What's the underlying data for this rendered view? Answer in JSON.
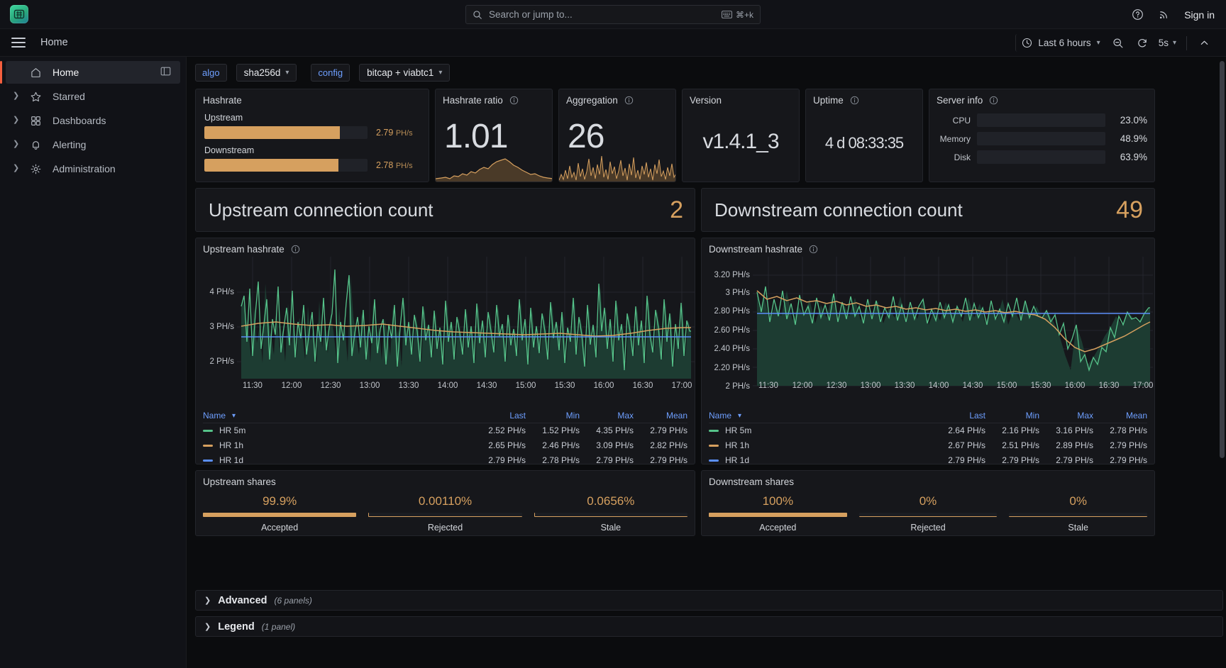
{
  "topbar": {
    "search_placeholder": "Search or jump to...",
    "kbd_shortcut": "⌘+k",
    "help_icon": "help-circle-icon",
    "news_icon": "rss-icon",
    "signin_label": "Sign in"
  },
  "subnav": {
    "breadcrumb": "Home",
    "time_range": "Last 6 hours",
    "zoom_out_icon": "zoom-out-icon",
    "refresh_icon": "refresh-icon",
    "refresh_interval": "5s",
    "collapse_icon": "chevron-up-icon"
  },
  "sidebar": {
    "items": [
      {
        "label": "Home",
        "icon": "home-icon",
        "active": true,
        "expandable": false
      },
      {
        "label": "Starred",
        "icon": "star-icon",
        "active": false,
        "expandable": true
      },
      {
        "label": "Dashboards",
        "icon": "dashboards-grid-icon",
        "active": false,
        "expandable": true
      },
      {
        "label": "Alerting",
        "icon": "bell-icon",
        "active": false,
        "expandable": true
      },
      {
        "label": "Administration",
        "icon": "gear-icon",
        "active": false,
        "expandable": true
      }
    ],
    "dock_icon": "dock-panel-icon"
  },
  "variables": [
    {
      "name": "algo",
      "value": "sha256d"
    },
    {
      "name": "config",
      "value": "bitcap + viabtc1"
    }
  ],
  "panels": {
    "hashrate": {
      "title": "Hashrate",
      "bars": [
        {
          "label": "Upstream",
          "value": "2.79",
          "unit": "PH/s",
          "pct": 83
        },
        {
          "label": "Downstream",
          "value": "2.78",
          "unit": "PH/s",
          "pct": 82
        }
      ]
    },
    "hashrate_ratio": {
      "title": "Hashrate ratio",
      "value": "1.01",
      "has_info": true
    },
    "aggregation": {
      "title": "Aggregation",
      "value": "26",
      "has_info": true
    },
    "version": {
      "title": "Version",
      "value": "v1.4.1_3",
      "has_info": false
    },
    "uptime": {
      "title": "Uptime",
      "value": "4 d 08:33:35",
      "has_info": true
    },
    "server_info": {
      "title": "Server info",
      "has_info": true,
      "rows": [
        {
          "name": "CPU",
          "pct_label": "23.0%",
          "pct": 23.0
        },
        {
          "name": "Memory",
          "pct_label": "48.9%",
          "pct": 48.9
        },
        {
          "name": "Disk",
          "pct_label": "63.9%",
          "pct": 63.9
        }
      ]
    },
    "upstream_conn": {
      "title": "Upstream connection count",
      "value": "2"
    },
    "downstream_conn": {
      "title": "Downstream connection count",
      "value": "49"
    },
    "upstream_shares": {
      "title": "Upstream shares",
      "cells": [
        {
          "value": "99.9%",
          "label": "Accepted",
          "pct": 99.9
        },
        {
          "value": "0.00110%",
          "label": "Rejected",
          "pct": 0.0011
        },
        {
          "value": "0.0656%",
          "label": "Stale",
          "pct": 0.0656
        }
      ]
    },
    "downstream_shares": {
      "title": "Downstream shares",
      "cells": [
        {
          "value": "100%",
          "label": "Accepted",
          "pct": 100
        },
        {
          "value": "0%",
          "label": "Rejected",
          "pct": 0
        },
        {
          "value": "0%",
          "label": "Stale",
          "pct": 0
        }
      ]
    }
  },
  "collapsed_rows": [
    {
      "title": "Advanced",
      "count": "(6 panels)"
    },
    {
      "title": "Legend",
      "count": "(1 panel)"
    }
  ],
  "colors": {
    "accent_orange": "#d6a05f",
    "series_green": "#56c38a",
    "series_blue": "#5b8ff9",
    "link_blue": "#6e9fff",
    "panel_bg": "#16171b",
    "canvas_bg": "#0b0c0e"
  },
  "chart_data": [
    {
      "type": "line",
      "title": "Upstream hashrate",
      "has_info": true,
      "xlabel": "",
      "ylabel": "",
      "ylim": [
        1.5,
        4.5
      ],
      "ytick_labels": [
        "4 PH/s",
        "3 PH/s",
        "2 PH/s"
      ],
      "ytick_values": [
        4,
        3,
        2
      ],
      "xtick_labels": [
        "11:30",
        "12:00",
        "12:30",
        "13:00",
        "13:30",
        "14:00",
        "14:30",
        "15:00",
        "15:30",
        "16:00",
        "16:30",
        "17:00"
      ],
      "grid": true,
      "legend_position": "bottom-table",
      "legend_columns": [
        "Name",
        "Last",
        "Min",
        "Max",
        "Mean"
      ],
      "series": [
        {
          "name": "HR 5m",
          "color": "#56c38a",
          "last": "2.52 PH/s",
          "min": "1.52 PH/s",
          "max": "4.35 PH/s",
          "mean": "2.79 PH/s"
        },
        {
          "name": "HR 1h",
          "color": "#d6a05f",
          "last": "2.65 PH/s",
          "min": "2.46 PH/s",
          "max": "3.09 PH/s",
          "mean": "2.82 PH/s"
        },
        {
          "name": "HR 1d",
          "color": "#5b8ff9",
          "last": "2.79 PH/s",
          "min": "2.78 PH/s",
          "max": "2.79 PH/s",
          "mean": "2.79 PH/s"
        }
      ]
    },
    {
      "type": "line",
      "title": "Downstream hashrate",
      "has_info": true,
      "xlabel": "",
      "ylabel": "",
      "ylim": [
        2.0,
        3.3
      ],
      "ytick_labels": [
        "3.20 PH/s",
        "3 PH/s",
        "2.80 PH/s",
        "2.60 PH/s",
        "2.40 PH/s",
        "2.20 PH/s",
        "2 PH/s"
      ],
      "ytick_values": [
        3.2,
        3.0,
        2.8,
        2.6,
        2.4,
        2.2,
        2.0
      ],
      "xtick_labels": [
        "11:30",
        "12:00",
        "12:30",
        "13:00",
        "13:30",
        "14:00",
        "14:30",
        "15:00",
        "15:30",
        "16:00",
        "16:30",
        "17:00"
      ],
      "grid": true,
      "legend_position": "bottom-table",
      "legend_columns": [
        "Name",
        "Last",
        "Min",
        "Max",
        "Mean"
      ],
      "series": [
        {
          "name": "HR 5m",
          "color": "#56c38a",
          "last": "2.64 PH/s",
          "min": "2.16 PH/s",
          "max": "3.16 PH/s",
          "mean": "2.78 PH/s"
        },
        {
          "name": "HR 1h",
          "color": "#d6a05f",
          "last": "2.67 PH/s",
          "min": "2.51 PH/s",
          "max": "2.89 PH/s",
          "mean": "2.79 PH/s"
        },
        {
          "name": "HR 1d",
          "color": "#5b8ff9",
          "last": "2.79 PH/s",
          "min": "2.79 PH/s",
          "max": "2.79 PH/s",
          "mean": "2.79 PH/s"
        }
      ]
    }
  ]
}
